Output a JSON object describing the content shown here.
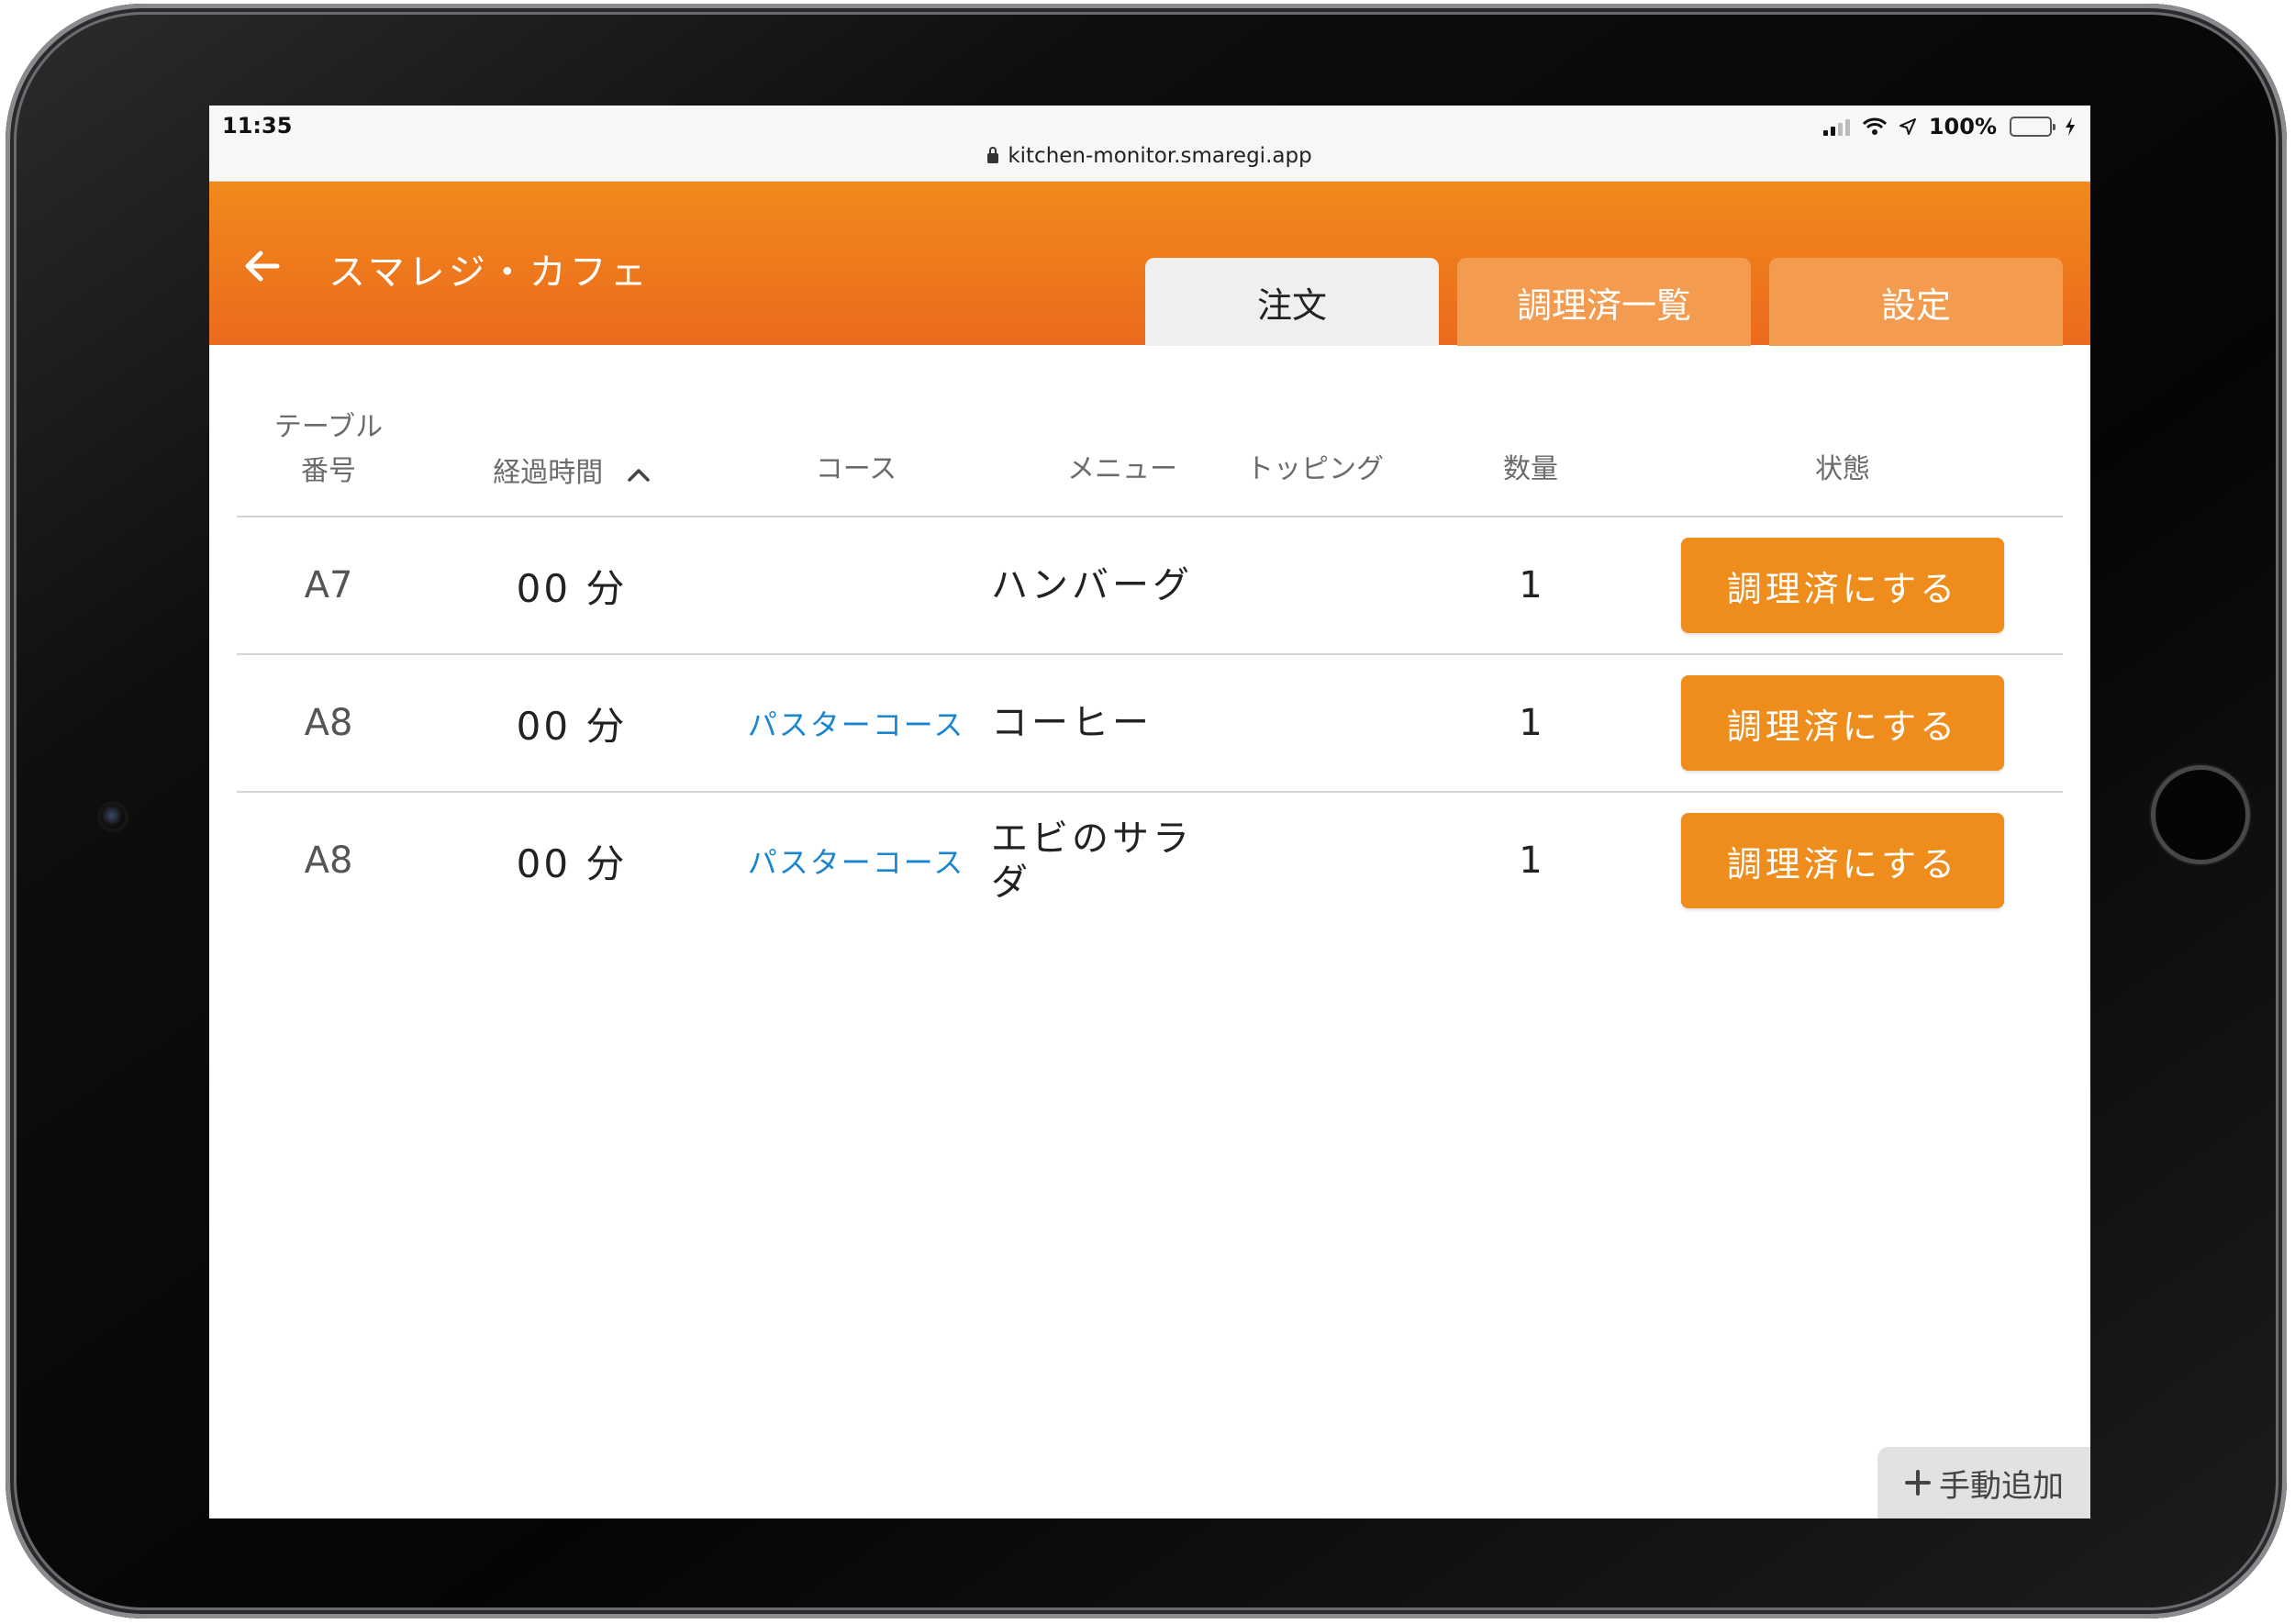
{
  "status_bar": {
    "time": "11:35",
    "url": "kitchen-monitor.smaregi.app",
    "battery": "100%",
    "battery_level": 1.0
  },
  "header": {
    "title": "スマレジ・カフェ",
    "back_icon": "arrow-left-icon",
    "tabs": [
      {
        "label": "注文",
        "active": true
      },
      {
        "label": "調理済一覧",
        "active": false
      },
      {
        "label": "設定",
        "active": false
      }
    ]
  },
  "table": {
    "columns": {
      "table_no_line1": "テーブル",
      "table_no_line2": "番号",
      "elapsed": "経過時間",
      "course": "コース",
      "menu": "メニュー",
      "topping": "トッピング",
      "quantity": "数量",
      "status": "状態"
    },
    "sort_icon": "chevron-up-icon",
    "rows": [
      {
        "table": "A7",
        "elapsed": "00 分",
        "course": "",
        "menu_line1": "ハンバーグ",
        "menu_line2": "",
        "topping": "",
        "quantity": "1",
        "action": "調理済にする"
      },
      {
        "table": "A8",
        "elapsed": "00 分",
        "course": "パスターコース",
        "menu_line1": "コーヒー",
        "menu_line2": "",
        "topping": "",
        "quantity": "1",
        "action": "調理済にする"
      },
      {
        "table": "A8",
        "elapsed": "00 分",
        "course": "パスターコース",
        "menu_line1": "エビのサラ",
        "menu_line2": "ダ",
        "topping": "",
        "quantity": "1",
        "action": "調理済にする"
      }
    ]
  },
  "manual_add": {
    "icon": "plus-icon",
    "label": "手動追加"
  },
  "colors": {
    "header_orange": "#ec6a1e",
    "button_orange": "#ee8d1c",
    "course_link_blue": "#1a86d0",
    "inactive_tab": "#f39b4f"
  }
}
